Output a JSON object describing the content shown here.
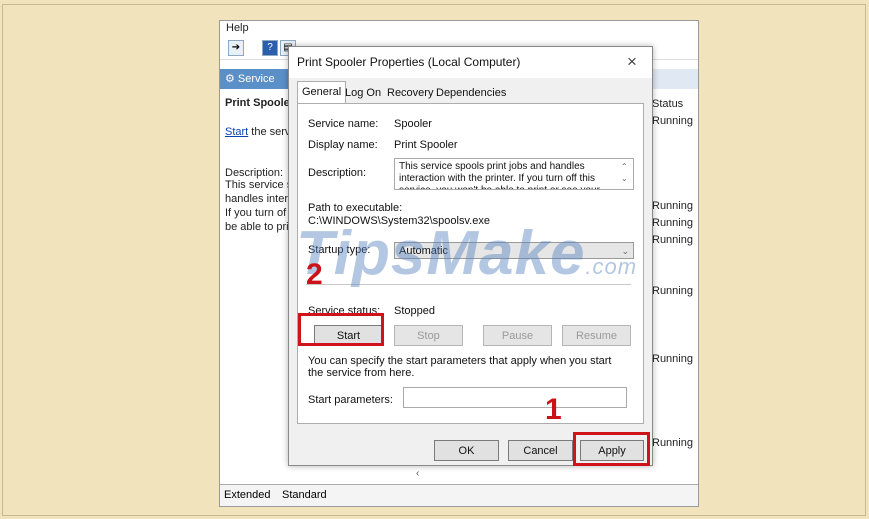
{
  "console": {
    "menu_help": "Help",
    "header_services": "Service",
    "left_title": "Print Spoole",
    "start_link": "Start",
    "start_rest": " the serv",
    "description_label": "Description:",
    "desc_lines": [
      "This service s",
      "handles inter",
      "If you turn of",
      "be able to pri"
    ],
    "status_header": "Status",
    "statuses": [
      "Running",
      "Running",
      "Running",
      "Running",
      "Running",
      "Running",
      "Running"
    ],
    "tab_extended": "Extended",
    "tab_standard": "Standard",
    "scroll_left": "‹"
  },
  "dialog": {
    "title": "Print Spooler Properties (Local Computer)",
    "close": "×",
    "tabs": [
      "General",
      "Log On",
      "Recovery",
      "Dependencies"
    ],
    "service_name_label": "Service name:",
    "service_name_value": "Spooler",
    "display_name_label": "Display name:",
    "display_name_value": "Print Spooler",
    "description_label": "Description:",
    "description_value": "This service spools print jobs and handles interaction with the printer.  If you turn off this service, you won't be able to print or see your printers.",
    "path_label": "Path to executable:",
    "path_value": "C:\\WINDOWS\\System32\\spoolsv.exe",
    "startup_type_label": "Startup type:",
    "startup_type_value": "Automatic",
    "service_status_label": "Service status:",
    "service_status_value": "Stopped",
    "btn_start": "Start",
    "btn_stop": "Stop",
    "btn_pause": "Pause",
    "btn_resume": "Resume",
    "help_text": "You can specify the start parameters that apply when you start the service from here.",
    "start_params_label": "Start parameters:",
    "btn_ok": "OK",
    "btn_cancel": "Cancel",
    "btn_apply": "Apply"
  },
  "annotations": {
    "step1": "1",
    "step2": "2",
    "highlight_color": "#d0121b"
  },
  "watermark": {
    "text": "TipsMake",
    "suffix": ".com"
  }
}
